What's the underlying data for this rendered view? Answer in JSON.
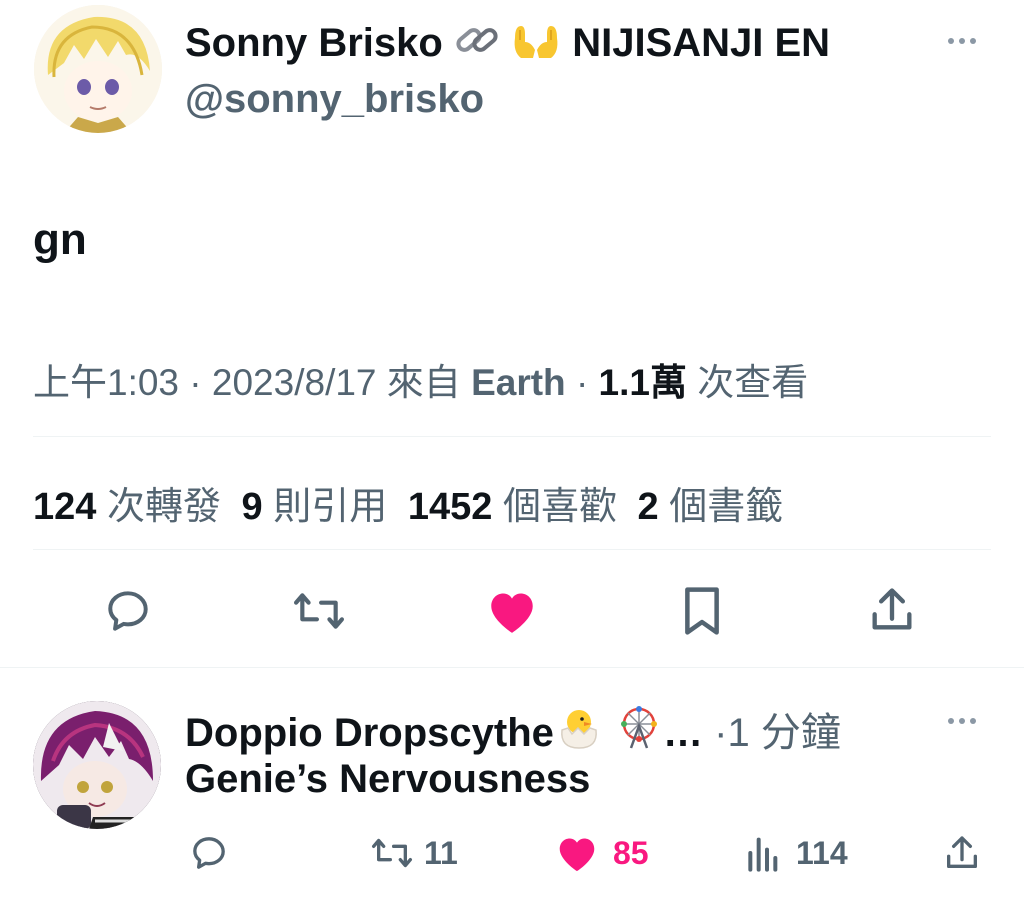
{
  "tweet": {
    "display_name": "Sonny Brisko",
    "name_suffix": "NIJISANJI EN",
    "handle": "@sonny_brisko",
    "text": "gn",
    "meta": {
      "time": "上午1:03",
      "separator": "·",
      "date": "2023/8/17",
      "source_prefix": "來自",
      "source": "Earth",
      "views_count": "1.1萬",
      "views_label": "次查看"
    },
    "stats": [
      {
        "count": "124",
        "label": "次轉發"
      },
      {
        "count": "9",
        "label": "則引用"
      },
      {
        "count": "1452",
        "label": "個喜歡"
      },
      {
        "count": "2",
        "label": "個書籤"
      }
    ],
    "icons": {
      "reply": "reply-icon",
      "retweet": "retweet-icon",
      "like": "heart-icon",
      "bookmark": "bookmark-icon",
      "share": "share-icon"
    },
    "like_active": true
  },
  "reply": {
    "display_name": "Doppio Dropscythe",
    "ellipsis": "…",
    "separator": "·",
    "time_ago": "1 分鐘",
    "text": "Genie’s Nervousness",
    "retweets": "11",
    "likes": "85",
    "views": "114"
  },
  "colors": {
    "text_primary": "#0f1419",
    "text_secondary": "#536471",
    "like_pink": "#f91880",
    "divider": "#eff3f4"
  }
}
